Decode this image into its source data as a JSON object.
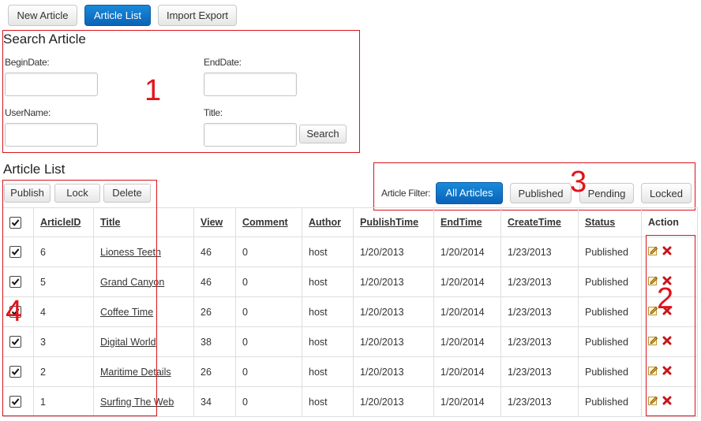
{
  "toolbar": {
    "new_article": "New Article",
    "article_list": "Article List",
    "import_export": "Import Export"
  },
  "search": {
    "heading": "Search Article",
    "begin_date_label": "BeginDate:",
    "end_date_label": "EndDate:",
    "username_label": "UserName:",
    "title_label": "Title:",
    "begin_date_value": "",
    "end_date_value": "",
    "username_value": "",
    "title_value": "",
    "search_button": "Search"
  },
  "list": {
    "heading": "Article List",
    "publish": "Publish",
    "lock": "Lock",
    "delete": "Delete"
  },
  "filter": {
    "label": "Article Filter:",
    "all": "All Articles",
    "published": "Published",
    "pending": "Pending",
    "locked": "Locked",
    "active": "all"
  },
  "table": {
    "headers": {
      "id": "ArticleID",
      "title": "Title",
      "view": "View",
      "comment": "Comment",
      "author": "Author",
      "publish_time": "PublishTime",
      "end_time": "EndTime",
      "create_time": "CreateTime",
      "status": "Status",
      "action": "Action"
    },
    "rows": [
      {
        "checked": true,
        "id": "6",
        "title": "Lioness Teeth",
        "view": "46",
        "comment": "0",
        "author": "host",
        "publish_time": "1/20/2013",
        "end_time": "1/20/2014",
        "create_time": "1/23/2013",
        "status": "Published"
      },
      {
        "checked": true,
        "id": "5",
        "title": "Grand Canyon",
        "view": "46",
        "comment": "0",
        "author": "host",
        "publish_time": "1/20/2013",
        "end_time": "1/20/2014",
        "create_time": "1/23/2013",
        "status": "Published"
      },
      {
        "checked": true,
        "id": "4",
        "title": "Coffee Time",
        "view": "26",
        "comment": "0",
        "author": "host",
        "publish_time": "1/20/2013",
        "end_time": "1/20/2014",
        "create_time": "1/23/2013",
        "status": "Published"
      },
      {
        "checked": true,
        "id": "3",
        "title": "Digital World",
        "view": "38",
        "comment": "0",
        "author": "host",
        "publish_time": "1/20/2013",
        "end_time": "1/20/2014",
        "create_time": "1/23/2013",
        "status": "Published"
      },
      {
        "checked": true,
        "id": "2",
        "title": "Maritime Details",
        "view": "26",
        "comment": "0",
        "author": "host",
        "publish_time": "1/20/2013",
        "end_time": "1/20/2014",
        "create_time": "1/23/2013",
        "status": "Published"
      },
      {
        "checked": true,
        "id": "1",
        "title": "Surfing The Web",
        "view": "34",
        "comment": "0",
        "author": "host",
        "publish_time": "1/20/2013",
        "end_time": "1/20/2014",
        "create_time": "1/23/2013",
        "status": "Published"
      }
    ]
  },
  "annotations": {
    "one": "1",
    "two": "2",
    "three": "3",
    "four": "4"
  },
  "icons": {
    "edit": "pencil-icon",
    "delete": "red-x-icon",
    "check": "checkmark-icon"
  },
  "colors": {
    "primary_button": "#0a63b8",
    "annotation_red": "#d9141b",
    "delete_red": "#c8141a"
  }
}
